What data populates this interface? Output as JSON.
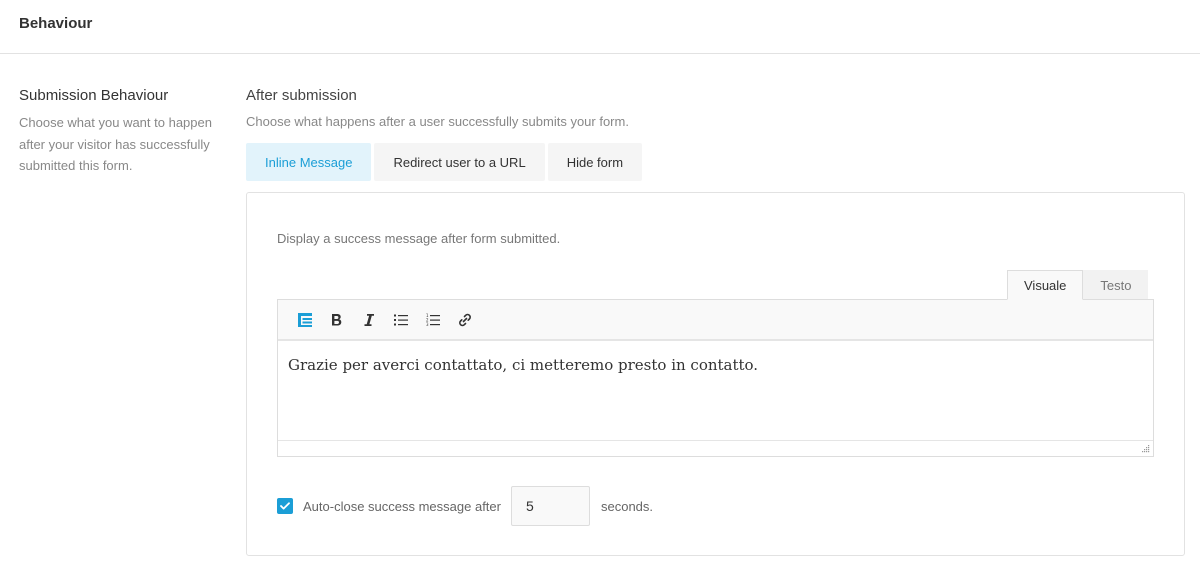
{
  "header": {
    "title": "Behaviour"
  },
  "section": {
    "title": "Submission Behaviour",
    "description": "Choose what you want to happen after your visitor has successfully submitted this form."
  },
  "field": {
    "title": "After submission",
    "description": "Choose what happens after a user successfully submits your form."
  },
  "tabs": [
    {
      "label": "Inline Message",
      "active": true
    },
    {
      "label": "Redirect user to a URL",
      "active": false
    },
    {
      "label": "Hide form",
      "active": false
    }
  ],
  "panel": {
    "description": "Display a success message after form submitted.",
    "editor_tabs": [
      {
        "label": "Visuale",
        "active": true
      },
      {
        "label": "Testo",
        "active": false
      }
    ],
    "toolbar": [
      "form-fields-icon",
      "bold-icon",
      "italic-icon",
      "bullet-list-icon",
      "numbered-list-icon",
      "link-icon"
    ],
    "content": "Grazie per averci contattato, ci metteremo presto in contatto."
  },
  "autoclose": {
    "checked": true,
    "label": "Auto-close success message after",
    "value": "5",
    "suffix": "seconds."
  },
  "colors": {
    "accent": "#1b9ed6",
    "active_tab_bg": "#e2f3fb"
  }
}
